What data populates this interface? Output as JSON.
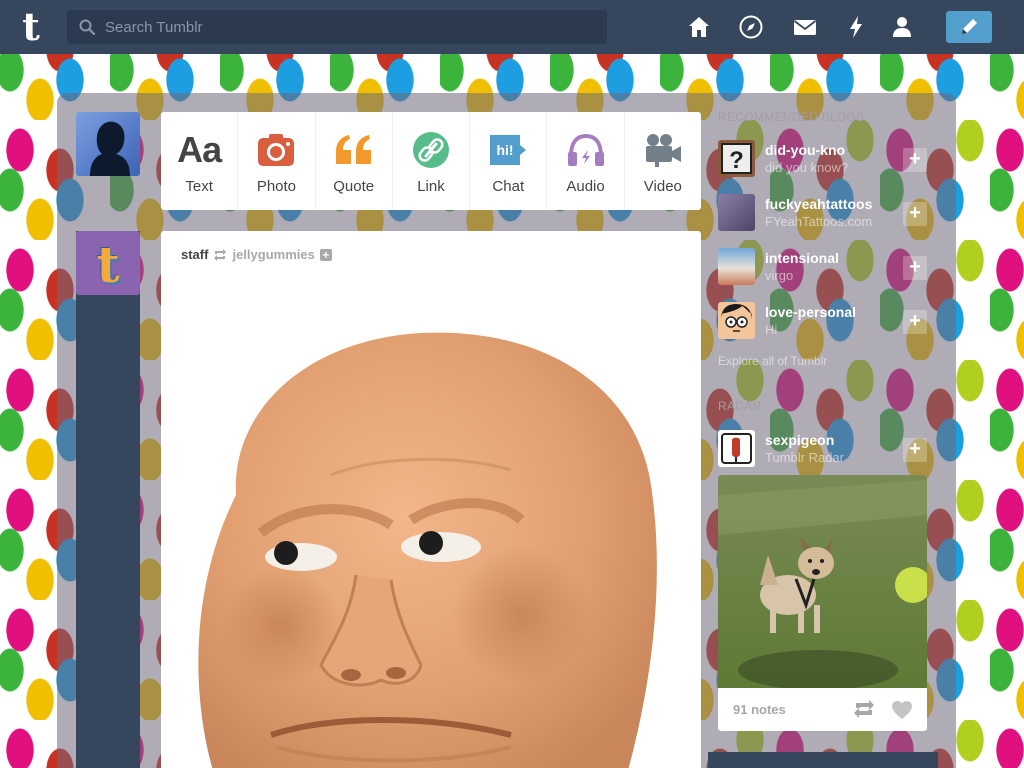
{
  "search": {
    "placeholder": "Search Tumblr"
  },
  "nav": [
    "home-icon",
    "explore-icon",
    "inbox-icon",
    "activity-icon",
    "account-icon"
  ],
  "compose": {
    "icon": "pencil-icon"
  },
  "post_types": [
    {
      "label": "Text",
      "icon": "text-icon",
      "color": "#444444"
    },
    {
      "label": "Photo",
      "icon": "camera-icon",
      "color": "#d95e40"
    },
    {
      "label": "Quote",
      "icon": "quote-icon",
      "color": "#f2992e"
    },
    {
      "label": "Link",
      "icon": "link-icon",
      "color": "#56bc8a"
    },
    {
      "label": "Chat",
      "icon": "chat-icon",
      "color": "#529ecc"
    },
    {
      "label": "Audio",
      "icon": "headphones-icon",
      "color": "#a77dc2"
    },
    {
      "label": "Video",
      "icon": "video-camera-icon",
      "color": "#748089"
    }
  ],
  "post": {
    "author": "staff",
    "reblogged_from": "jellygummies"
  },
  "sidebar": {
    "recommended_heading": "RECOMMENDED BLOGS",
    "recommended": [
      {
        "name": "did-you-kno",
        "subtitle": "did you know?"
      },
      {
        "name": "fuckyeahtattoos",
        "subtitle": "FYeahTattoos.com"
      },
      {
        "name": "intensional",
        "subtitle": "virgo"
      },
      {
        "name": "love-personal",
        "subtitle": "Hi"
      }
    ],
    "explore_link": "Explore all of Tumblr",
    "radar_heading": "RADAR",
    "radar": {
      "name": "sexpigeon",
      "subtitle": "Tumblr Radar",
      "notes": "91 notes"
    }
  },
  "colors": {
    "nav_bg": "#36465d",
    "accent": "#529ecc"
  }
}
